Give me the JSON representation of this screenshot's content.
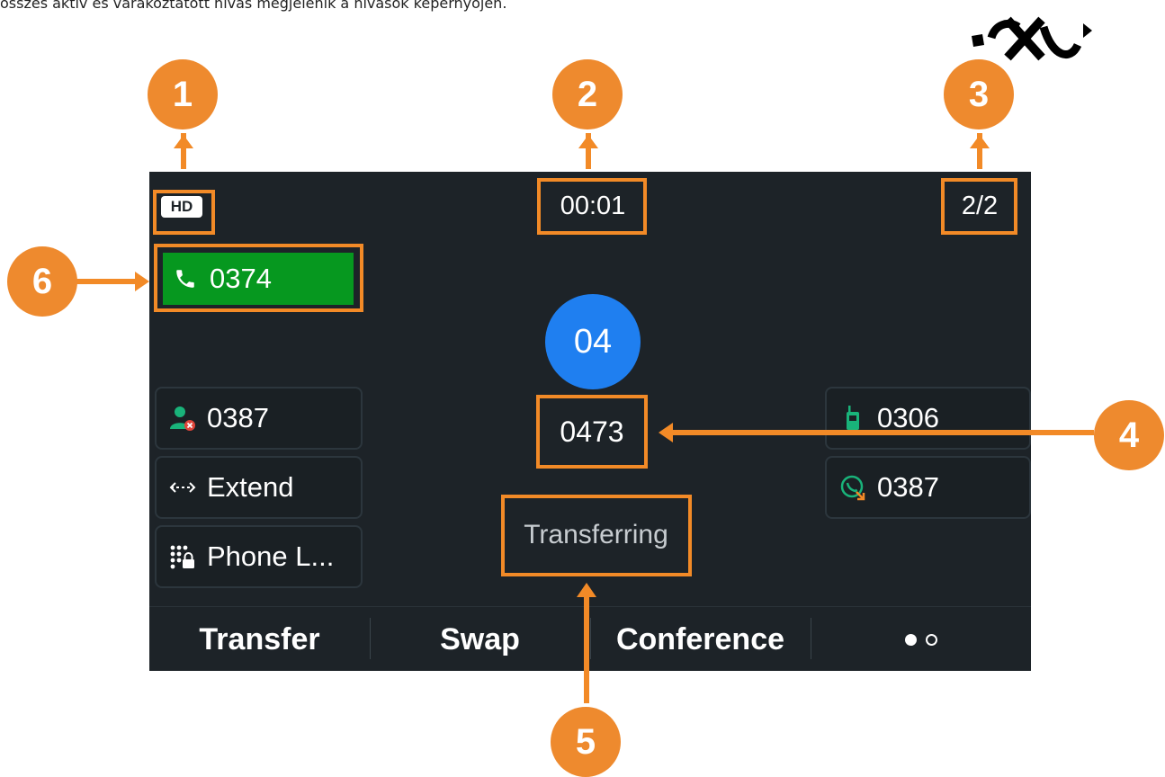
{
  "caption": "összes aktív és várakoztatott hívás megjelenik a hívások képernyőjén.",
  "colors": {
    "screen_bg": "#1d2328",
    "accent_orange": "#f28a27",
    "active_line_green": "#06981f",
    "avatar_blue": "#1f7ff0"
  },
  "header": {
    "hd_badge": "HD",
    "timer": "00:01",
    "call_count": "2/2"
  },
  "active_line": {
    "icon": "phone-icon",
    "label": "0374"
  },
  "left_keys": [
    {
      "icon": "contact-blocked-icon",
      "label": "0387"
    },
    {
      "icon": "extend-arrows-icon",
      "label": "Extend"
    },
    {
      "icon": "phone-lock-icon",
      "label": "Phone L..."
    }
  ],
  "right_keys": [
    {
      "icon": "walkie-talkie-icon",
      "label": "0306"
    },
    {
      "icon": "call-pickup-icon",
      "label": "0387"
    }
  ],
  "call": {
    "avatar_text": "04",
    "number": "0473",
    "status": "Transferring"
  },
  "softkeys": {
    "transfer": "Transfer",
    "swap": "Swap",
    "conference": "Conference",
    "page_indicator": {
      "current": 1,
      "total": 2
    }
  },
  "callouts": [
    "1",
    "2",
    "3",
    "4",
    "5",
    "6"
  ]
}
